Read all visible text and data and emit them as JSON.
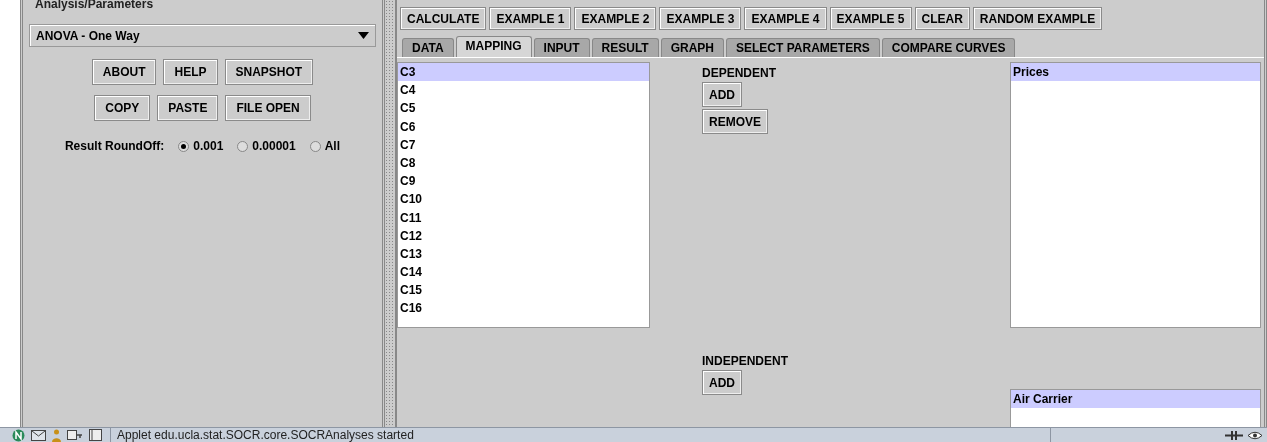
{
  "left_panel": {
    "section_label": "Analysis/Parameters",
    "analysis_dropdown": {
      "value": "ANOVA - One Way"
    },
    "button_rows": [
      [
        "ABOUT",
        "HELP",
        "SNAPSHOT"
      ],
      [
        "COPY",
        "PASTE",
        "FILE OPEN"
      ]
    ],
    "roundoff": {
      "label": "Result RoundOff:",
      "options": [
        {
          "label": "0.001",
          "selected": true
        },
        {
          "label": "0.00001",
          "selected": false
        },
        {
          "label": "All",
          "selected": false
        }
      ]
    }
  },
  "toolbar": {
    "buttons": [
      "CALCULATE",
      "EXAMPLE 1",
      "EXAMPLE 2",
      "EXAMPLE 3",
      "EXAMPLE 4",
      "EXAMPLE 5",
      "CLEAR",
      "RANDOM EXAMPLE"
    ]
  },
  "tabs": [
    {
      "label": "DATA",
      "selected": false
    },
    {
      "label": "MAPPING",
      "selected": true
    },
    {
      "label": "INPUT",
      "selected": false
    },
    {
      "label": "RESULT",
      "selected": false
    },
    {
      "label": "GRAPH",
      "selected": false
    },
    {
      "label": "SELECT PARAMETERS",
      "selected": false
    },
    {
      "label": "COMPARE CURVES",
      "selected": false
    }
  ],
  "mapping": {
    "variables": [
      {
        "label": "C3",
        "selected": true
      },
      {
        "label": "C4",
        "selected": false
      },
      {
        "label": "C5",
        "selected": false
      },
      {
        "label": "C6",
        "selected": false
      },
      {
        "label": "C7",
        "selected": false
      },
      {
        "label": "C8",
        "selected": false
      },
      {
        "label": "C9",
        "selected": false
      },
      {
        "label": "C10",
        "selected": false
      },
      {
        "label": "C11",
        "selected": false
      },
      {
        "label": "C12",
        "selected": false
      },
      {
        "label": "C13",
        "selected": false
      },
      {
        "label": "C14",
        "selected": false
      },
      {
        "label": "C15",
        "selected": false
      },
      {
        "label": "C16",
        "selected": false
      }
    ],
    "dependent": {
      "label": "DEPENDENT",
      "buttons": [
        "ADD",
        "REMOVE"
      ],
      "list": [
        {
          "label": "Prices",
          "selected": true
        }
      ]
    },
    "independent": {
      "label": "INDEPENDENT",
      "buttons": [
        "ADD"
      ],
      "list": [
        {
          "label": "Air Carrier",
          "selected": true
        }
      ]
    }
  },
  "status_bar": {
    "text": "Applet edu.ucla.stat.SOCR.core.SOCRAnalyses started"
  }
}
